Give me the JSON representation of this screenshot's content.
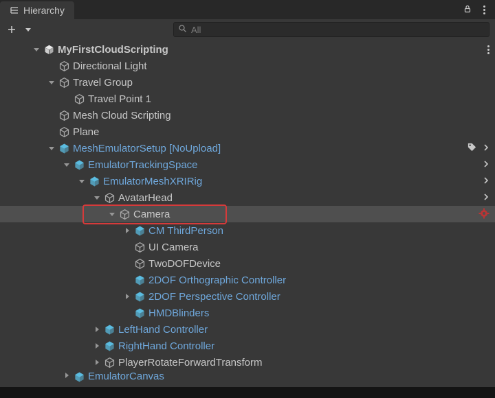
{
  "panel": {
    "title": "Hierarchy"
  },
  "search": {
    "placeholder": "All"
  },
  "colors": {
    "prefabBlue": "#6fa8dc",
    "iconGray": "#a9a9a9",
    "iconBlue": "#5bbce0"
  },
  "tree": [
    {
      "depth": 0,
      "arrow": "down",
      "icon": "unity-logo",
      "label": "MyFirstCloudScripting",
      "style": "gray bold",
      "trail": [
        "dots"
      ]
    },
    {
      "depth": 1,
      "arrow": "none",
      "icon": "cube-gray",
      "label": "Directional Light",
      "style": "gray"
    },
    {
      "depth": 1,
      "arrow": "down",
      "icon": "cube-gray",
      "label": "Travel Group",
      "style": "gray"
    },
    {
      "depth": 2,
      "arrow": "none",
      "icon": "cube-gray",
      "label": "Travel Point 1",
      "style": "gray"
    },
    {
      "depth": 1,
      "arrow": "none",
      "icon": "cube-gray",
      "label": "Mesh Cloud Scripting",
      "style": "gray"
    },
    {
      "depth": 1,
      "arrow": "none",
      "icon": "cube-gray",
      "label": "Plane",
      "style": "gray"
    },
    {
      "depth": 1,
      "arrow": "down",
      "icon": "cube-blue",
      "label": "MeshEmulatorSetup [NoUpload]",
      "style": "blue",
      "trail": [
        "tag",
        "chevron"
      ]
    },
    {
      "depth": 2,
      "arrow": "down",
      "icon": "cube-blue",
      "label": "EmulatorTrackingSpace",
      "style": "blue",
      "trail": [
        "chevron"
      ]
    },
    {
      "depth": 3,
      "arrow": "down",
      "icon": "cube-blue",
      "label": "EmulatorMeshXRIRig",
      "style": "blue",
      "trail": [
        "chevron"
      ]
    },
    {
      "depth": 4,
      "arrow": "down",
      "icon": "cube-gray",
      "label": "AvatarHead",
      "style": "gray",
      "trail": [
        "chevron"
      ]
    },
    {
      "depth": 5,
      "arrow": "down",
      "icon": "cube-gray",
      "label": "Camera",
      "style": "gray",
      "selected": true,
      "highlighted": true,
      "trail": [
        "gear"
      ]
    },
    {
      "depth": 6,
      "arrow": "right",
      "icon": "cube-blue",
      "label": "CM ThirdPerson",
      "style": "blue"
    },
    {
      "depth": 6,
      "arrow": "none",
      "icon": "cube-gray",
      "label": "UI Camera",
      "style": "gray"
    },
    {
      "depth": 6,
      "arrow": "none",
      "icon": "cube-gray",
      "label": "TwoDOFDevice",
      "style": "gray"
    },
    {
      "depth": 6,
      "arrow": "none",
      "icon": "cube-blue",
      "label": "2DOF Orthographic Controller",
      "style": "blue"
    },
    {
      "depth": 6,
      "arrow": "right",
      "icon": "cube-blue",
      "label": "2DOF Perspective Controller",
      "style": "blue"
    },
    {
      "depth": 6,
      "arrow": "none",
      "icon": "cube-blue",
      "label": "HMDBlinders",
      "style": "blue"
    },
    {
      "depth": 4,
      "arrow": "right",
      "icon": "cube-blue",
      "label": "LeftHand Controller",
      "style": "blue"
    },
    {
      "depth": 4,
      "arrow": "right",
      "icon": "cube-blue",
      "label": "RightHand Controller",
      "style": "blue"
    },
    {
      "depth": 4,
      "arrow": "right",
      "icon": "cube-gray",
      "label": "PlayerRotateForwardTransform",
      "style": "gray"
    },
    {
      "depth": 2,
      "arrow": "right",
      "icon": "cube-blue",
      "label": "EmulatorCanvas",
      "style": "blue",
      "cut": true
    }
  ]
}
